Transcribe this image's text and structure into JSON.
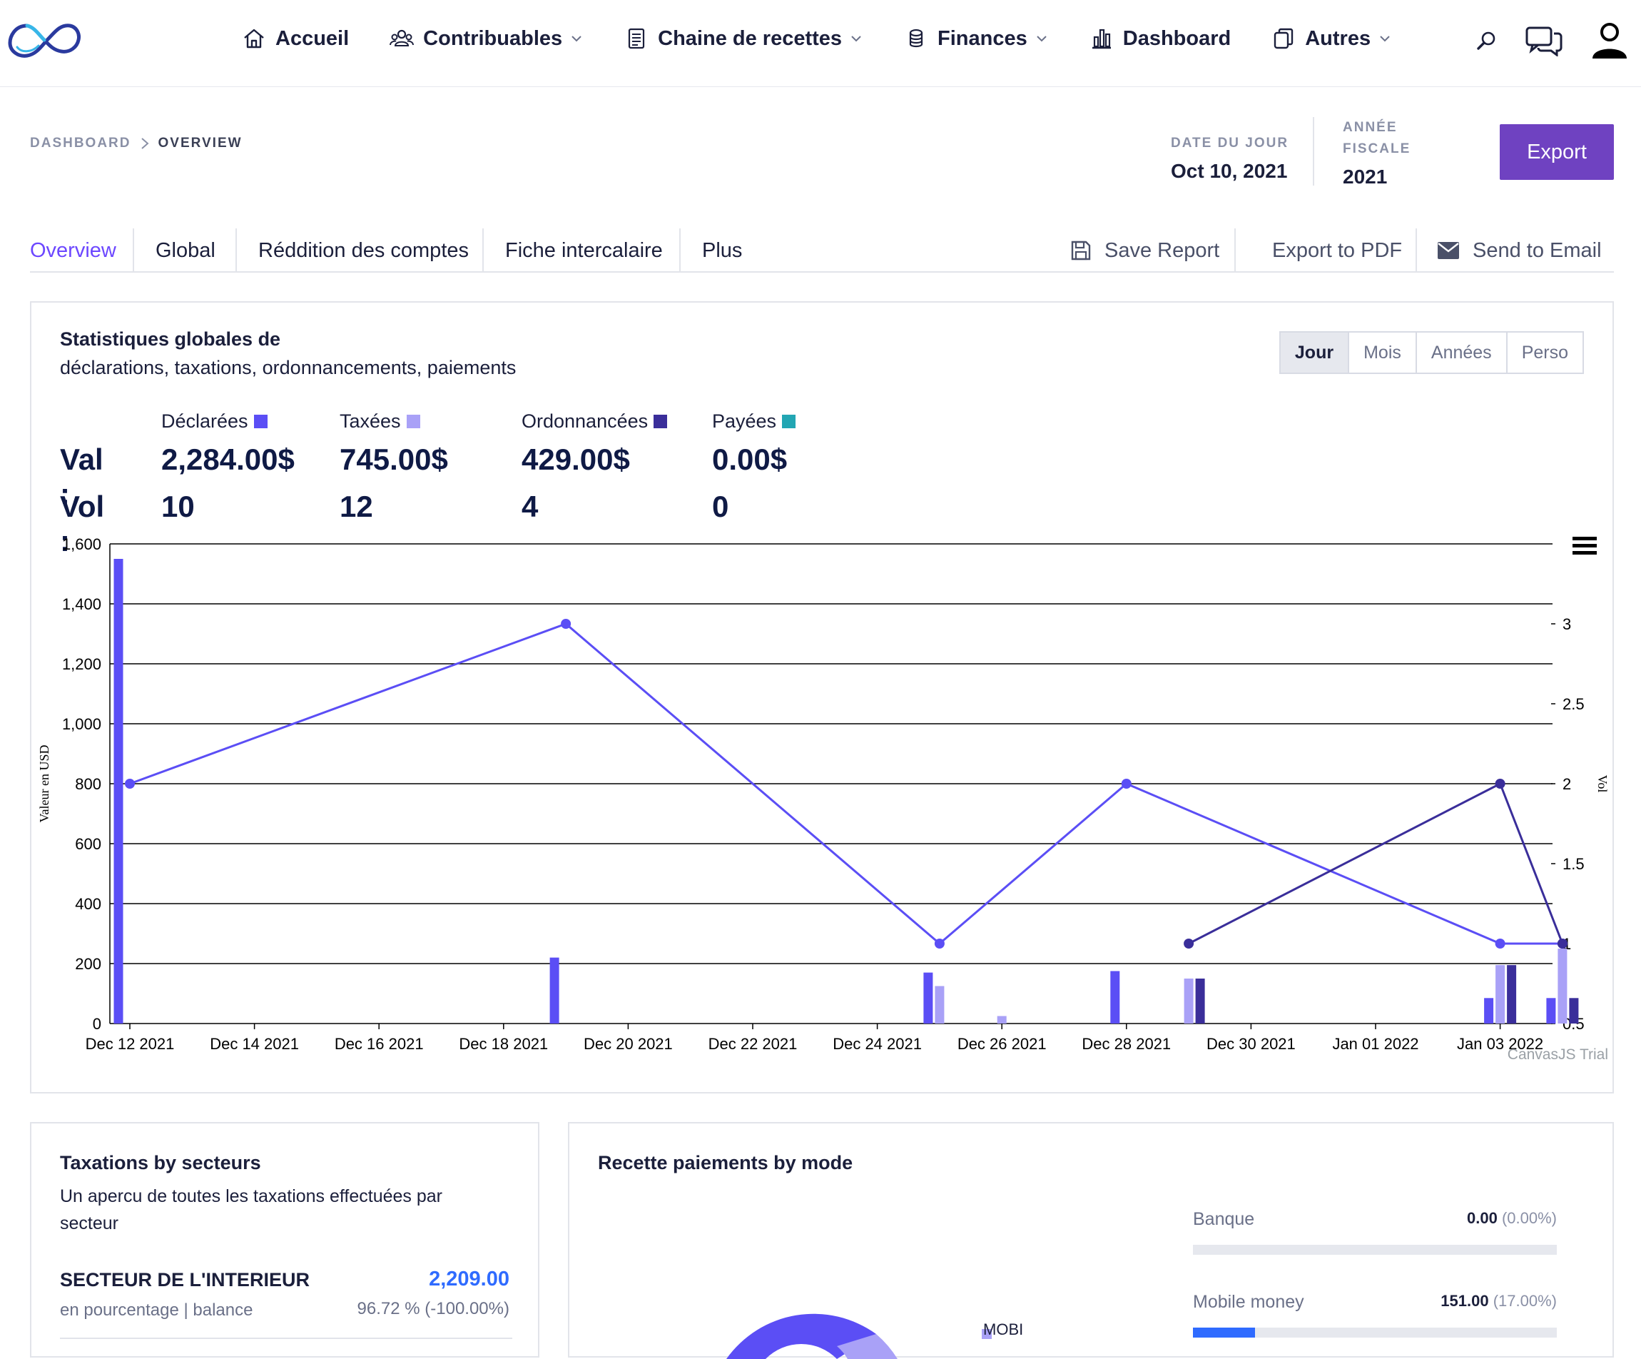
{
  "nav": {
    "items": [
      {
        "label": "Accueil",
        "icon": "home-icon",
        "dropdown": false
      },
      {
        "label": "Contribuables",
        "icon": "people-icon",
        "dropdown": true
      },
      {
        "label": "Chaine de recettes",
        "icon": "document-icon",
        "dropdown": true
      },
      {
        "label": "Finances",
        "icon": "coins-icon",
        "dropdown": true
      },
      {
        "label": "Dashboard",
        "icon": "bar-chart-icon",
        "dropdown": false
      },
      {
        "label": "Autres",
        "icon": "copy-icon",
        "dropdown": true
      }
    ],
    "right_icons": [
      "search-icon",
      "chat-icon",
      "user-icon"
    ]
  },
  "header": {
    "breadcrumb": [
      "DASHBOARD",
      "OVERVIEW"
    ],
    "date_label": "DATE DU JOUR",
    "date_value": "Oct 10, 2021",
    "fiscal_label_1": "ANNÉE",
    "fiscal_label_2": "FISCALE",
    "fiscal_value": "2021",
    "export_label": "Export"
  },
  "tabs": {
    "items": [
      "Overview",
      "Global",
      "Réddition des comptes",
      "Fiche intercalaire",
      "Plus"
    ],
    "active": "Overview",
    "actions": {
      "save": "Save Report",
      "pdf": "Export to PDF",
      "email": "Send to Email"
    }
  },
  "stats_card": {
    "title": "Statistiques globales de",
    "subtitle": "déclarations, taxations, ordonnancements, paiements",
    "periods": [
      "Jour",
      "Mois",
      "Années",
      "Perso"
    ],
    "active_period": "Jour",
    "val_label": "Val :",
    "vol_label": "Vol :",
    "columns": [
      {
        "label": "Déclarées",
        "val": "2,284.00$",
        "vol": "10",
        "color": "#5b4ef5"
      },
      {
        "label": "Taxées",
        "val": "745.00$",
        "vol": "12",
        "color": "#a9a1f7"
      },
      {
        "label": "Ordonnancées",
        "val": "429.00$",
        "vol": "4",
        "color": "#3a2e9a"
      },
      {
        "label": "Payées",
        "val": "0.00$",
        "vol": "0",
        "color": "#22a6b3"
      }
    ]
  },
  "chart_data": {
    "type": "bar",
    "title": "",
    "ylabel": "Valeur en USD",
    "y2label": "Vol",
    "ylim": [
      0,
      1600
    ],
    "y2lim": [
      0.5,
      3.5
    ],
    "yticks": [
      "0",
      "200",
      "400",
      "600",
      "800",
      "1,000",
      "1,200",
      "1,400",
      "1,600"
    ],
    "y2ticks": [
      "0.5",
      "1",
      "1.5",
      "2",
      "2.5",
      "3"
    ],
    "x_range": [
      "2021-12-12",
      "2022-01-04"
    ],
    "xticks": [
      "Dec 12 2021",
      "Dec 14 2021",
      "Dec 16 2021",
      "Dec 18 2021",
      "Dec 20 2021",
      "Dec 22 2021",
      "Dec 24 2021",
      "Dec 26 2021",
      "Dec 28 2021",
      "Dec 30 2021",
      "Jan 01 2022",
      "Jan 03 2022"
    ],
    "bar_series": [
      {
        "name": "Déclarées",
        "color": "#5b4ef5",
        "points": [
          [
            "2021-12-12",
            1550
          ],
          [
            "2021-12-19",
            220
          ],
          [
            "2021-12-25",
            170
          ],
          [
            "2021-12-28",
            175
          ],
          [
            "2022-01-03",
            85
          ],
          [
            "2022-01-04",
            85
          ]
        ]
      },
      {
        "name": "Taxées",
        "color": "#a9a1f7",
        "points": [
          [
            "2021-12-25",
            125
          ],
          [
            "2021-12-26",
            25
          ],
          [
            "2021-12-29",
            150
          ],
          [
            "2022-01-03",
            195
          ],
          [
            "2022-01-04",
            250
          ]
        ]
      },
      {
        "name": "Ordonnancées",
        "color": "#3a2e9a",
        "points": [
          [
            "2021-12-29",
            150
          ],
          [
            "2022-01-03",
            195
          ],
          [
            "2022-01-04",
            85
          ]
        ]
      }
    ],
    "line_series": [
      {
        "name": "Déclarées",
        "color": "#5b4ef5",
        "points": [
          [
            "2021-12-12",
            2
          ],
          [
            "2021-12-19",
            3
          ],
          [
            "2021-12-25",
            1
          ],
          [
            "2021-12-28",
            2
          ],
          [
            "2022-01-03",
            1
          ],
          [
            "2022-01-04",
            1
          ]
        ]
      },
      {
        "name": "Ordonnancées",
        "color": "#3a2e9a",
        "points": [
          [
            "2021-12-29",
            1
          ],
          [
            "2022-01-03",
            2
          ],
          [
            "2022-01-04",
            1
          ]
        ]
      }
    ],
    "grid": true,
    "watermark": "CanvasJS Trial"
  },
  "sector_card": {
    "title": "Taxations by secteurs",
    "subtitle": "Un apercu de toutes les taxations effectuées par secteur",
    "sector_name": "SECTEUR DE L'INTERIEUR",
    "sector_amount": "2,209.00",
    "sector_note": "en pourcentage | balance",
    "sector_pct": "96.72 % (-100.00%)"
  },
  "mode_card": {
    "title": "Recette paiements by mode",
    "modes": [
      {
        "label": "Banque",
        "value": "0.00",
        "pct": "(0.00%)",
        "fill": 0
      },
      {
        "label": "Mobile money",
        "value": "151.00",
        "pct": "(17.00%)",
        "fill": 0.17
      }
    ],
    "donut_label": "MOBI"
  }
}
